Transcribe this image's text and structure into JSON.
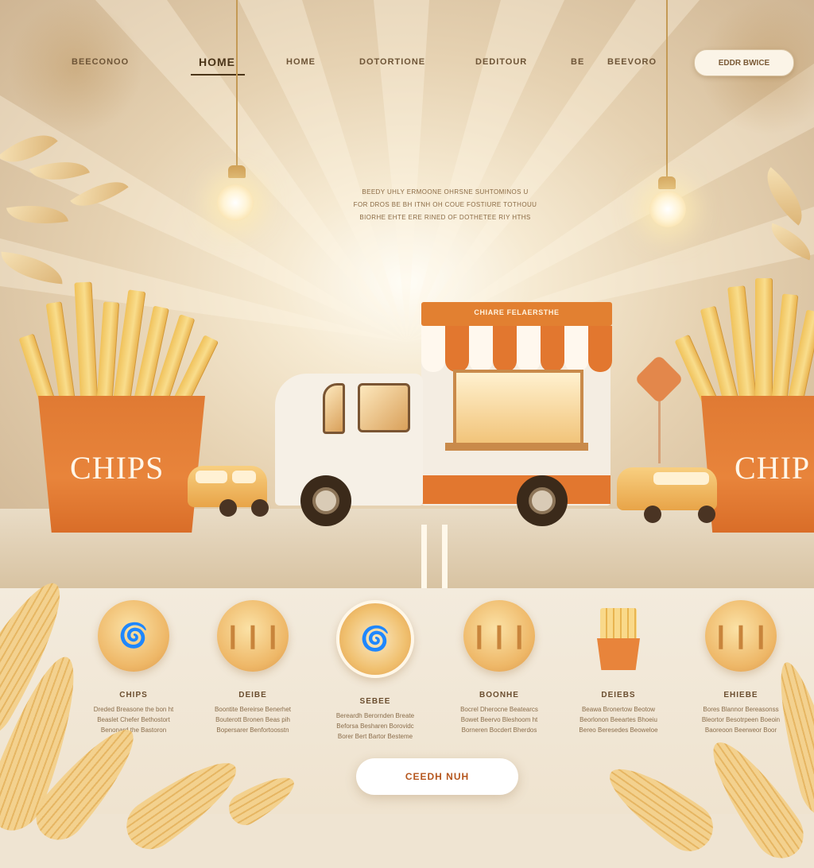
{
  "nav": {
    "brand": "BEECONOO",
    "items": [
      {
        "label": "HOME",
        "active": true
      },
      {
        "label": "HOME",
        "active": false
      },
      {
        "label": "DOTORTIONE",
        "active": false
      },
      {
        "label": "DEDITOUR",
        "active": false
      },
      {
        "label": "BE",
        "active": false
      },
      {
        "label": "BEEVORO",
        "active": false
      }
    ],
    "cta_label": "EDDR BWICE"
  },
  "hero": {
    "tagline": [
      "BEEDY UHLY ERMOONE OHRSNE SUHTOMINOS U",
      "FOR DROS BE BH ITNH OH COUE FOSTIURE TOTHOUU",
      "BIORHE EHTE ERE RINED OF DOTHETEE RIY HTHS"
    ],
    "truck_sign": "CHIARE FELAERSTHE",
    "box_label_left": "CHIPS",
    "box_label_right": "CHIP"
  },
  "products": [
    {
      "name": "CHIPS",
      "desc": [
        "Dreded Breasone the bon ht",
        "Beaslet Chefer Bethostort",
        "Benonard the Bastoron"
      ]
    },
    {
      "name": "DEIBE",
      "desc": [
        "Boontite Bereirse Benerhet",
        "Bouterott Bronen Beas pih",
        "Bopersarer Benfortoosstn"
      ]
    },
    {
      "name": "SEBEE",
      "desc": [
        "Bereardh Berornden Breate",
        "Beforsa Besharen Borovidc",
        "Borer Bert Bartor Besteme"
      ]
    },
    {
      "name": "BOONHE",
      "desc": [
        "Bocrel Dherocne Beatearcs",
        "Bowet Beervo Bleshoom ht",
        "Borneren Bocdert Bherdos"
      ]
    },
    {
      "name": "DEIEBS",
      "desc": [
        "Beawa Bronertow Beotow",
        "Beorlonon Beeartes Bhoeiu",
        "Bereo Beresedes Beoweloe"
      ]
    },
    {
      "name": "EHIEBE",
      "desc": [
        "Bores Blannor Bereasonss",
        "Bleortor Besotrpeen Boeoin",
        "Baoreoon Beerweor Boor"
      ]
    }
  ],
  "cta": {
    "label": "CEEDH NUH"
  },
  "colors": {
    "accent": "#e2772f",
    "brand_text": "#6e5537",
    "cta_text": "#b5561d"
  },
  "icons": [
    "lamp-icon",
    "leaf-icon",
    "sauce-swirl-icon",
    "fries-icon"
  ]
}
